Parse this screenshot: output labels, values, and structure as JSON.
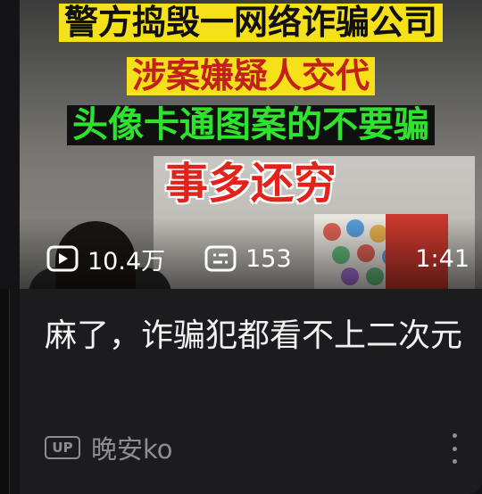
{
  "video": {
    "captions": [
      "警方捣毁一网络诈骗公司",
      "涉案嫌疑人交代",
      "头像卡通图案的不要骗",
      "事多还穷"
    ],
    "views": "10.4万",
    "comments": "153",
    "duration": "1:41",
    "title": "麻了，诈骗犯都看不上二次元",
    "uploader_badge": "UP",
    "uploader": "晚安ko",
    "icons": {
      "views": "play-icon",
      "comments": "danmaku-icon",
      "menu": "more-vertical-icon"
    }
  }
}
